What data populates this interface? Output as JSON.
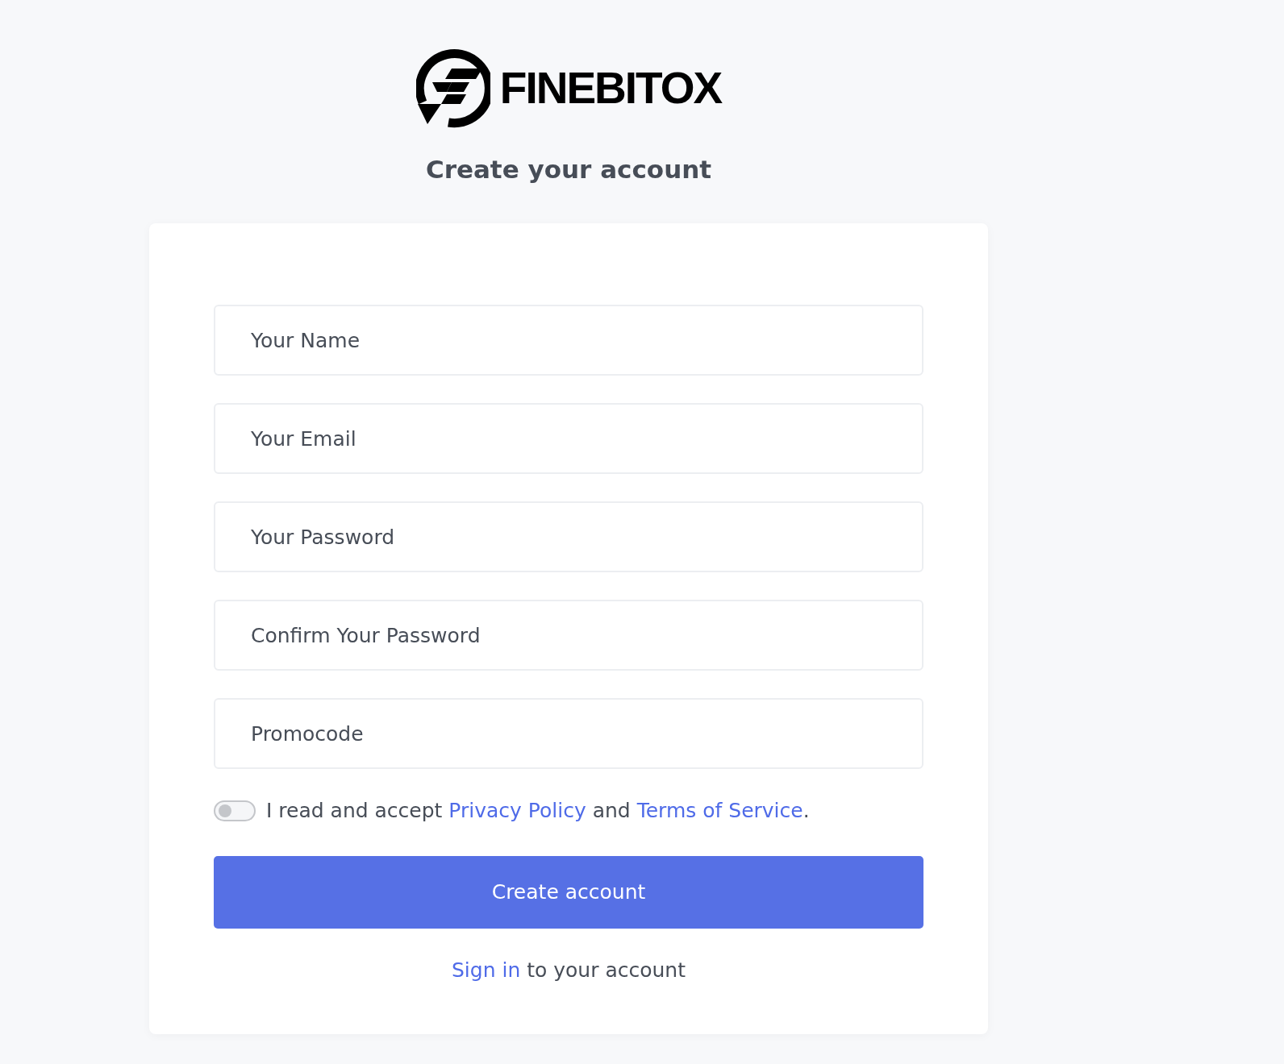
{
  "logo": {
    "text": "FINEBITOX"
  },
  "heading": "Create your account",
  "fields": [
    {
      "placeholder": "Your Name"
    },
    {
      "placeholder": "Your Email"
    },
    {
      "placeholder": "Your Password"
    },
    {
      "placeholder": "Confirm Your Password"
    },
    {
      "placeholder": "Promocode"
    }
  ],
  "agreement": {
    "toggle": {
      "on": false
    },
    "parts": [
      {
        "kind": "text",
        "text": "I read and accept "
      },
      {
        "kind": "link",
        "text": "Privacy Policy"
      },
      {
        "kind": "text",
        "text": " and "
      },
      {
        "kind": "link",
        "text": "Terms of Service"
      },
      {
        "kind": "text",
        "text": "."
      }
    ]
  },
  "submit_button": {
    "label": "Create account"
  },
  "signin": {
    "parts": [
      {
        "kind": "link",
        "text": "Sign in"
      },
      {
        "kind": "text",
        "text": " to your account"
      }
    ]
  }
}
